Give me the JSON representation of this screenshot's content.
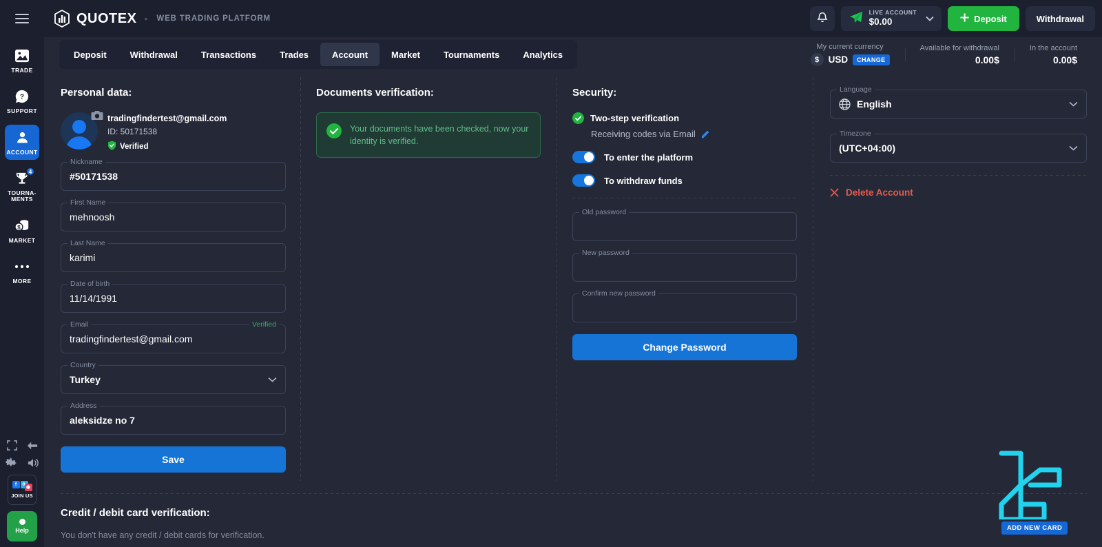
{
  "app": {
    "logo_text": "QUOTEX",
    "logo_subtitle": "WEB TRADING PLATFORM",
    "separator_dot": "•"
  },
  "sidebar": {
    "items": [
      {
        "label": "TRADE",
        "icon": "chart-image-icon",
        "active": false,
        "badge": ""
      },
      {
        "label": "SUPPORT",
        "icon": "question-bubble-icon",
        "active": false,
        "badge": ""
      },
      {
        "label": "ACCOUNT",
        "icon": "user-icon",
        "active": true,
        "badge": ""
      },
      {
        "label": "TOURNA-MENTS",
        "icon": "trophy-icon",
        "active": false,
        "badge": "4"
      },
      {
        "label": "MARKET",
        "icon": "coins-icon",
        "active": false,
        "badge": ""
      },
      {
        "label": "MORE",
        "icon": "ellipsis-icon",
        "active": false,
        "badge": ""
      }
    ],
    "bottom": {
      "fullscreen_icon": "fullscreen-icon",
      "collapse_icon": "arrow-left-icon",
      "settings_icon": "gear-icon",
      "sound_icon": "speaker-icon",
      "join_us_label": "JOIN US",
      "join_us_icons": [
        "facebook-icon",
        "telegram-icon",
        "instagram-icon"
      ],
      "help_label": "Help"
    }
  },
  "header": {
    "notifications_icon": "bell-icon",
    "account_type": "LIVE ACCOUNT",
    "account_balance": "$0.00",
    "account_icon": "paper-plane-icon",
    "deposit_label": "Deposit",
    "withdrawal_label": "Withdrawal"
  },
  "tabs": [
    {
      "label": "Deposit",
      "active": false
    },
    {
      "label": "Withdrawal",
      "active": false
    },
    {
      "label": "Transactions",
      "active": false
    },
    {
      "label": "Trades",
      "active": false
    },
    {
      "label": "Account",
      "active": true
    },
    {
      "label": "Market",
      "active": false
    },
    {
      "label": "Tournaments",
      "active": false
    },
    {
      "label": "Analytics",
      "active": false
    }
  ],
  "stats": {
    "currency_label": "My current currency",
    "currency_symbol": "$",
    "currency_code": "USD",
    "change_label": "CHANGE",
    "available_label": "Available for withdrawal",
    "available_value": "0.00$",
    "in_account_label": "In the account",
    "in_account_value": "0.00$"
  },
  "personal_data": {
    "title": "Personal data:",
    "email": "tradingfindertest@gmail.com",
    "id": "ID: 50171538",
    "verified_label": "Verified",
    "camera_icon": "camera-icon",
    "fields": [
      {
        "legend": "Nickname",
        "value": "#50171538",
        "bold": true,
        "type": "text"
      },
      {
        "legend": "First Name",
        "value": "mehnoosh",
        "bold": false,
        "type": "text"
      },
      {
        "legend": "Last Name",
        "value": "karimi",
        "bold": false,
        "type": "text"
      },
      {
        "legend": "Date of birth",
        "value": "11/14/1991",
        "bold": false,
        "type": "text"
      },
      {
        "legend": "Email",
        "value": "tradingfindertest@gmail.com",
        "bold": false,
        "type": "text",
        "legend_right": "Verified"
      },
      {
        "legend": "Country",
        "value": "Turkey",
        "bold": true,
        "type": "select"
      },
      {
        "legend": "Address",
        "value": "aleksidze no 7",
        "bold": true,
        "type": "text"
      }
    ],
    "save_label": "Save"
  },
  "documents": {
    "title": "Documents verification:",
    "status_icon": "check-circle-icon",
    "status_text": "Your documents have been checked, now your identity is verified."
  },
  "security": {
    "title": "Security:",
    "two_step_label": "Two-step verification",
    "two_step_icon": "check-circle-icon",
    "receiving_codes": "Receiving codes via Email",
    "edit_icon": "pencil-icon",
    "toggles": [
      {
        "label": "To enter the platform",
        "on": true
      },
      {
        "label": "To withdraw funds",
        "on": true
      }
    ],
    "password_fields": [
      {
        "legend": "Old password",
        "value": ""
      },
      {
        "legend": "New password",
        "value": ""
      },
      {
        "legend": "Confirm new password",
        "value": ""
      }
    ],
    "change_password_label": "Change Password"
  },
  "settings": {
    "language": {
      "legend": "Language",
      "value": "English",
      "icon": "globe-icon"
    },
    "timezone": {
      "legend": "Timezone",
      "value": "(UTC+04:00)"
    },
    "delete_account_label": "Delete Account",
    "delete_icon": "close-x-icon"
  },
  "card_verification": {
    "title": "Credit / debit card verification:",
    "empty_note": "You don't have any credit / debit cards for verification.",
    "add_card_label": "ADD NEW CARD"
  },
  "colors": {
    "background": "#242837",
    "panel": "#1b1f2e",
    "accent_blue": "#1574d5",
    "accent_green": "#21b43f",
    "danger_red": "#e25c4e",
    "cyan": "#22d3ee",
    "muted_text": "#868d9f"
  }
}
